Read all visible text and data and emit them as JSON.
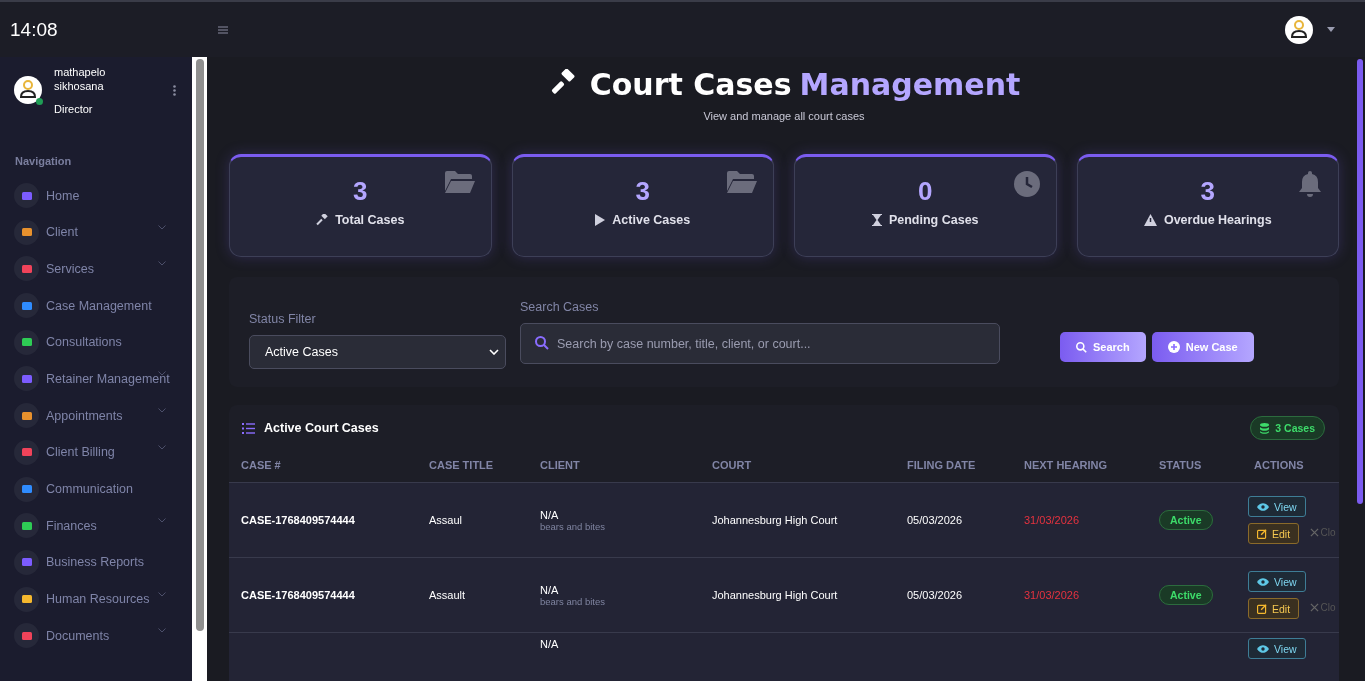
{
  "topbar": {
    "time": "14:08"
  },
  "user": {
    "name": "mathapelo sikhosana",
    "role": "Director",
    "online": true
  },
  "nav": {
    "heading": "Navigation",
    "items": [
      {
        "label": "Home",
        "color": "#7c5cff",
        "expandable": false
      },
      {
        "label": "Client",
        "color": "#e8912d",
        "expandable": true
      },
      {
        "label": "Services",
        "color": "#f0435a",
        "expandable": true
      },
      {
        "label": "Case Management",
        "color": "#2f8cff",
        "expandable": false
      },
      {
        "label": "Consultations",
        "color": "#2ecc55",
        "expandable": false
      },
      {
        "label": "Retainer Management",
        "color": "#7c5cff",
        "expandable": true
      },
      {
        "label": "Appointments",
        "color": "#e8912d",
        "expandable": true
      },
      {
        "label": "Client Billing",
        "color": "#f0435a",
        "expandable": true
      },
      {
        "label": "Communication",
        "color": "#2f8cff",
        "expandable": false
      },
      {
        "label": "Finances",
        "color": "#2ecc55",
        "expandable": true
      },
      {
        "label": "Business Reports",
        "color": "#7c5cff",
        "expandable": false
      },
      {
        "label": "Human Resources",
        "color": "#f5b82e",
        "expandable": true
      },
      {
        "label": "Documents",
        "color": "#f0435a",
        "expandable": true
      }
    ]
  },
  "header": {
    "title": "Court Cases",
    "title_accent": "Management",
    "subtitle": "View and manage all court cases"
  },
  "stats": [
    {
      "value": "3",
      "label": "Total Cases"
    },
    {
      "value": "3",
      "label": "Active Cases"
    },
    {
      "value": "0",
      "label": "Pending Cases"
    },
    {
      "value": "3",
      "label": "Overdue Hearings"
    }
  ],
  "filters": {
    "status_label": "Status Filter",
    "status_value": "Active Cases",
    "search_label": "Search Cases",
    "search_placeholder": "Search by case number, title, client, or court...",
    "search_button": "Search",
    "new_button": "New Case"
  },
  "table": {
    "title": "Active Court Cases",
    "count_badge": "3 Cases",
    "columns": [
      "CASE #",
      "CASE TITLE",
      "CLIENT",
      "COURT",
      "FILING DATE",
      "NEXT HEARING",
      "STATUS",
      "ACTIONS"
    ],
    "rows": [
      {
        "case_number": "CASE-1768409574444",
        "title": "Assaul",
        "client": "N/A",
        "client_note": "bears and bites",
        "court": "Johannesburg High Court",
        "filing_date": "05/03/2026",
        "next_hearing": "31/03/2026",
        "overdue": true,
        "status": "Active",
        "actions": [
          "View",
          "Edit"
        ],
        "close": "Clo"
      },
      {
        "case_number": "CASE-1768409574444",
        "title": "Assault",
        "client": "N/A",
        "client_note": "bears and bites",
        "court": "Johannesburg High Court",
        "filing_date": "05/03/2026",
        "next_hearing": "31/03/2026",
        "overdue": true,
        "status": "Active",
        "actions": [
          "View",
          "Edit"
        ],
        "close": "Clo"
      },
      {
        "client": "N/A",
        "actions": [
          "View"
        ]
      }
    ]
  }
}
